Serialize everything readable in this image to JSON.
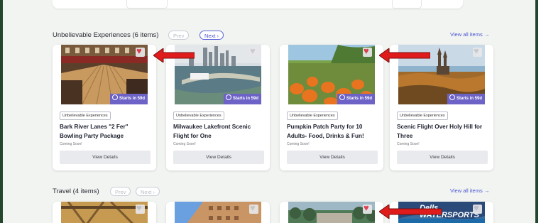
{
  "sections": [
    {
      "title": "Unbelievable Experiences (6 items)",
      "prev_label": "Prev",
      "next_label": "Next",
      "view_all": "View all items",
      "cards": [
        {
          "category": "Unbelievable Experiences",
          "title": "Bark River Lanes \"2 Fer\" Bowling Party Package",
          "status": "Coming Soon!",
          "badge": "Starts in 59d",
          "button": "View Details",
          "favorited": true
        },
        {
          "category": "Unbelievable Experiences",
          "title": "Milwaukee Lakefront Scenic Flight for One",
          "status": "Coming Soon!",
          "badge": "Starts in 59d",
          "button": "View Details",
          "favorited": false
        },
        {
          "category": "Unbelievable Experiences",
          "title": "Pumpkin Patch Party for 10 Adults- Food, Drinks & Fun!",
          "status": "Coming Soon!",
          "badge": "Starts in 59d",
          "button": "View Details",
          "favorited": true
        },
        {
          "category": "Unbelievable Experiences",
          "title": "Scenic Flight Over Holy Hill for Three",
          "status": "Coming Soon!",
          "badge": "Starts in 59d",
          "button": "View Details",
          "favorited": false
        }
      ]
    },
    {
      "title": "Travel (4 items)",
      "prev_label": "Prev",
      "next_label": "Next",
      "view_all": "View all items",
      "cards": [
        {
          "favorited": false
        },
        {
          "favorited": false
        },
        {
          "favorited": true,
          "image_text": "Dells WATERSPORTS"
        },
        {
          "favorited": false
        }
      ]
    }
  ],
  "colors": {
    "accent": "#4b55d0",
    "badge": "#6d63c7",
    "heart": "#e23b4a",
    "arrow": "#e01b1b",
    "frame": "#23462d"
  },
  "icons": {
    "favorite": "heart-icon",
    "badge": "clock-icon",
    "view_all": "arrow-right-icon"
  }
}
